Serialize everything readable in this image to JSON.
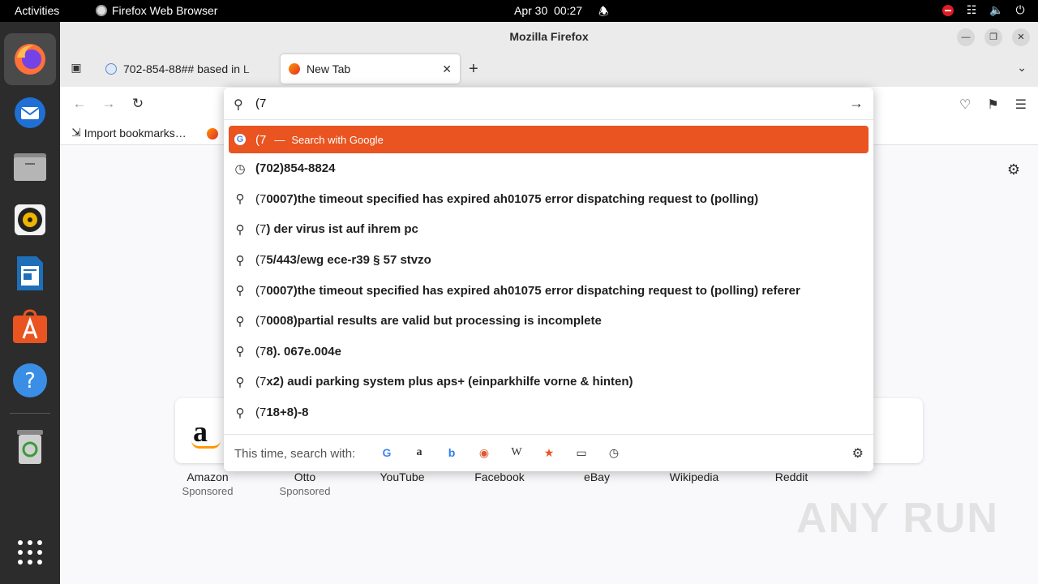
{
  "topbar": {
    "activities": "Activities",
    "app_name": "Firefox Web Browser",
    "date": "Apr 30",
    "time": "00:27"
  },
  "dock": {
    "items": [
      "firefox-icon",
      "thunderbird-icon",
      "files-icon",
      "rhythmbox-icon",
      "writer-icon",
      "app-center-icon",
      "help-icon",
      "trash-icon",
      "app-grid-icon"
    ]
  },
  "window": {
    "title": "Mozilla Firefox",
    "tabs": [
      {
        "title": "702-854-88## based in L"
      },
      {
        "title": "New Tab"
      }
    ]
  },
  "bookmarks": {
    "import_label": "Import bookmarks…"
  },
  "urlbar": {
    "value": "(7",
    "selected": {
      "typed": "(7",
      "separator": "—",
      "action": "Search with Google"
    },
    "results": [
      {
        "icon": "history-icon",
        "prefix": "",
        "text": "(702)854-8824"
      },
      {
        "icon": "search-icon",
        "prefix": "(7",
        "text": "0007)the timeout specified has expired ah01075 error dispatching request to (polling)"
      },
      {
        "icon": "search-icon",
        "prefix": "(7",
        "text": ") der virus ist auf ihrem pc"
      },
      {
        "icon": "search-icon",
        "prefix": "(7",
        "text": "5/443/ewg ece-r39 § 57 stvzo"
      },
      {
        "icon": "search-icon",
        "prefix": "(7",
        "text": "0007)the timeout specified has expired ah01075 error dispatching request to (polling) referer"
      },
      {
        "icon": "search-icon",
        "prefix": "(7",
        "text": "0008)partial results are valid but processing is incomplete"
      },
      {
        "icon": "search-icon",
        "prefix": "(7",
        "text": "8). 067e.004e"
      },
      {
        "icon": "search-icon",
        "prefix": "(7",
        "text": "x2) audi parking system plus aps+ (einparkhilfe vorne & hinten)"
      },
      {
        "icon": "search-icon",
        "prefix": "(7",
        "text": "18+8)-8"
      }
    ],
    "oneoff_label": "This time, search with:",
    "engines": [
      "google-icon",
      "amazon-icon",
      "bing-icon",
      "duckduckgo-icon",
      "wikipedia-icon",
      "bookmarks-icon",
      "tabs-icon",
      "history-icon"
    ]
  },
  "top_sites": [
    {
      "label": "Amazon",
      "sub": "Sponsored"
    },
    {
      "label": "Otto",
      "sub": "Sponsored"
    },
    {
      "label": "YouTube",
      "sub": ""
    },
    {
      "label": "Facebook",
      "sub": ""
    },
    {
      "label": "eBay",
      "sub": ""
    },
    {
      "label": "Wikipedia",
      "sub": ""
    },
    {
      "label": "Reddit",
      "sub": ""
    }
  ],
  "watermark": "ANY RUN",
  "colors": {
    "accent": "#e95420",
    "dock_bg": "#2c2c2c",
    "topbar_bg": "#000000"
  }
}
